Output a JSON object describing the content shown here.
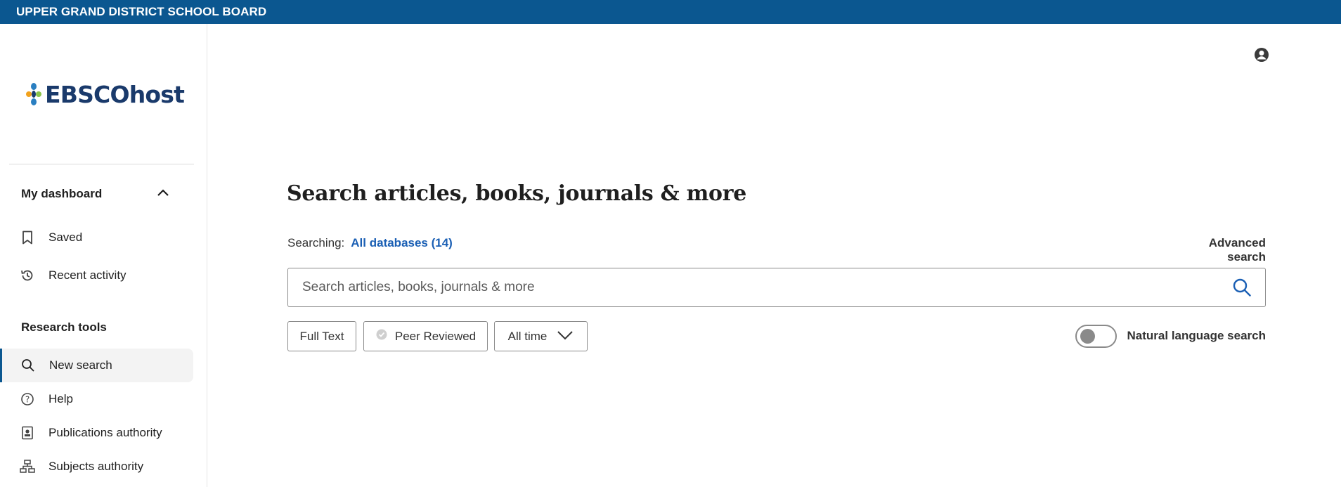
{
  "header": {
    "institution": "UPPER GRAND DISTRICT SCHOOL BOARD"
  },
  "brand": {
    "logo_text": "EBSCOhost"
  },
  "sidebar": {
    "dashboard": {
      "title": "My dashboard",
      "items": [
        {
          "label": "Saved",
          "icon": "bookmark-icon"
        },
        {
          "label": "Recent activity",
          "icon": "history-icon"
        }
      ]
    },
    "research_tools": {
      "title": "Research tools",
      "items": [
        {
          "label": "New search",
          "icon": "search-icon",
          "active": true
        },
        {
          "label": "Help",
          "icon": "help-icon"
        },
        {
          "label": "Publications authority",
          "icon": "publication-icon"
        },
        {
          "label": "Subjects authority",
          "icon": "hierarchy-icon"
        }
      ]
    }
  },
  "main": {
    "title": "Search articles, books, journals & more",
    "searching_label": "Searching:",
    "databases_link": "All databases (14)",
    "advanced_search": "Advanced search",
    "search": {
      "placeholder": "Search articles, books, journals & more",
      "value": ""
    },
    "filters": {
      "full_text": "Full Text",
      "peer_reviewed": "Peer Reviewed",
      "date_range": "All time"
    },
    "natural_language": {
      "label": "Natural language search",
      "enabled": false
    }
  },
  "colors": {
    "brand_bar": "#0b5790",
    "link": "#1a5fb4",
    "logo_navy": "#1a3a6b"
  }
}
